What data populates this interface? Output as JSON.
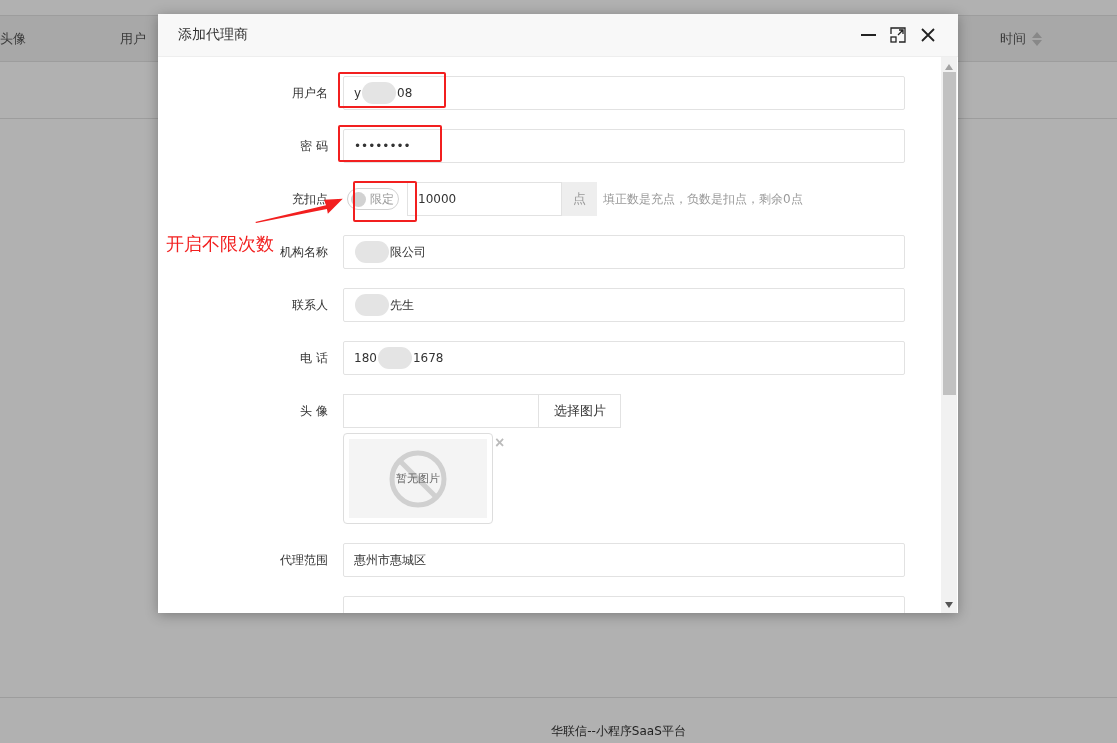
{
  "background": {
    "table_columns": [
      {
        "label": "头像",
        "sortable": false
      },
      {
        "label": "用户",
        "sortable": false
      },
      {
        "label": "时间",
        "sortable": true
      }
    ],
    "footer": "华联信--小程序SaaS平台"
  },
  "dialog": {
    "title": "添加代理商",
    "fields": [
      {
        "kind": "text",
        "label": "用户名",
        "segments": [
          {
            "text": "y"
          },
          {
            "blur": true
          },
          {
            "text": "08"
          }
        ],
        "highlighted": true
      },
      {
        "kind": "password",
        "label": "密 码",
        "segments": [
          {
            "text": "••••••••"
          }
        ],
        "highlighted": true
      },
      {
        "kind": "points",
        "label": "充扣点",
        "toggle": {
          "label": "限定",
          "on": false,
          "highlighted": true
        },
        "value": "10000",
        "addon": "点",
        "hint": "填正数是充点，负数是扣点，剩余0点",
        "annotation": "开启不限次数"
      },
      {
        "kind": "text",
        "label": "机构名称",
        "segments": [
          {
            "blur": true
          },
          {
            "text": "限公司"
          }
        ]
      },
      {
        "kind": "text",
        "label": "联系人",
        "segments": [
          {
            "blur": true
          },
          {
            "text": "先生"
          }
        ]
      },
      {
        "kind": "text",
        "label": "电 话",
        "segments": [
          {
            "text": "180"
          },
          {
            "blur": true
          },
          {
            "text": "1678"
          }
        ]
      },
      {
        "kind": "image",
        "label": "头 像",
        "button": "选择图片",
        "preview_text": "暂无图片",
        "remove": "×"
      },
      {
        "kind": "text",
        "label": "代理范围",
        "segments": [
          {
            "text": "惠州市惠城区"
          }
        ]
      },
      {
        "kind": "partial"
      }
    ]
  }
}
